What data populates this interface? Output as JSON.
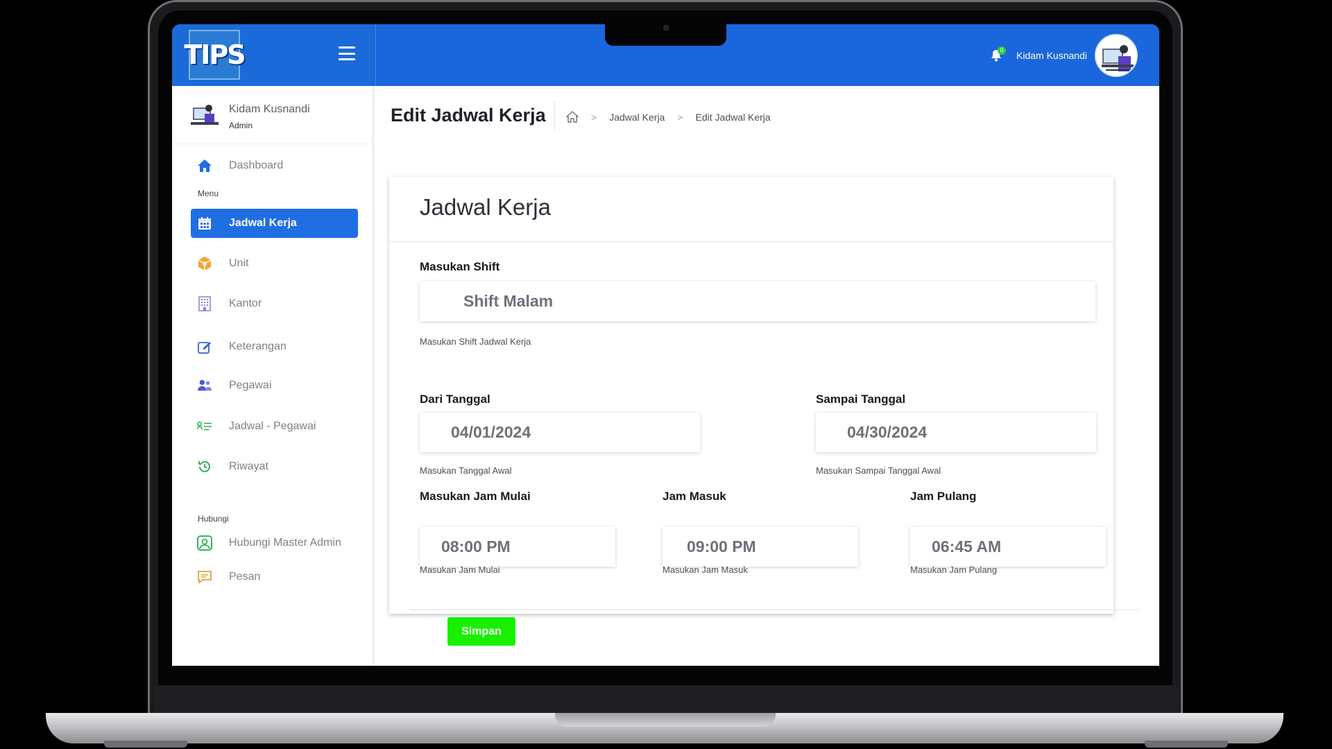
{
  "app": {
    "logo_text": "TIPS"
  },
  "topbar": {
    "user_name": "Kidam Kusnandi",
    "notification_count": "0"
  },
  "sidebar": {
    "profile": {
      "name": "Kidam Kusnandi",
      "role": "Admin"
    },
    "dashboard": "Dashboard",
    "section_menu": "Menu",
    "items": [
      {
        "label": "Jadwal Kerja",
        "active": true
      },
      {
        "label": "Unit"
      },
      {
        "label": "Kantor"
      },
      {
        "label": "Keterangan"
      },
      {
        "label": "Pegawai"
      },
      {
        "label": "Jadwal - Pegawai"
      },
      {
        "label": "Riwayat"
      }
    ],
    "section_contact": "Hubungi",
    "contact_items": [
      {
        "label": "Hubungi Master Admin"
      },
      {
        "label": "Pesan"
      }
    ]
  },
  "header": {
    "title": "Edit Jadwal Kerja",
    "breadcrumb": [
      "Jadwal Kerja",
      "Edit Jadwal Kerja"
    ]
  },
  "form": {
    "card_title": "Jadwal Kerja",
    "shift": {
      "label": "Masukan Shift",
      "value": "Shift Malam",
      "help": "Masukan Shift Jadwal Kerja"
    },
    "start_date": {
      "label": "Dari Tanggal",
      "value": "04/01/2024",
      "help": "Masukan Tanggal Awal"
    },
    "end_date": {
      "label": "Sampai Tanggal",
      "value": "04/30/2024",
      "help": "Masukan Sampai Tanggal Awal"
    },
    "start_time": {
      "label": "Masukan Jam Mulai",
      "value": "08:00 PM",
      "help": "Masukan Jam Mulai"
    },
    "in_time": {
      "label": "Jam Masuk",
      "value": "09:00 PM",
      "help": "Masukan Jam Masuk"
    },
    "out_time": {
      "label": "Jam Pulang",
      "value": "06:45 AM",
      "help": "Masukan Jam Pulang"
    },
    "save_label": "Simpan"
  },
  "colors": {
    "primary": "#1a66dc",
    "save": "#18f000",
    "active_nav": "#1f6ee3"
  }
}
